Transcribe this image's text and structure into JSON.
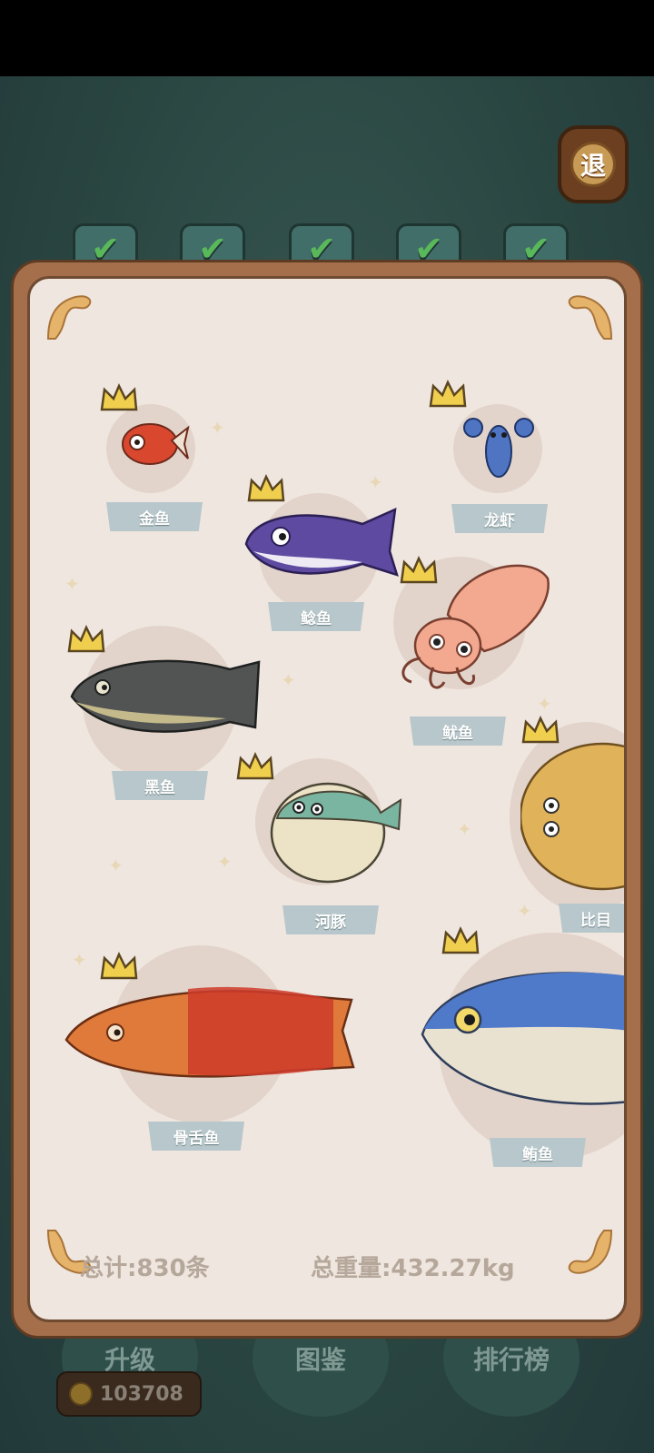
{
  "exit_button": {
    "label": "退"
  },
  "tabs": [
    {
      "label": "",
      "completed": true
    },
    {
      "label": "",
      "completed": true
    },
    {
      "label": "",
      "completed": true
    },
    {
      "label": "",
      "completed": true
    },
    {
      "label": "",
      "completed": true
    }
  ],
  "collection": {
    "fish": [
      {
        "name": "金鱼",
        "crowned": true,
        "icon": "goldfish"
      },
      {
        "name": "龙虾",
        "crowned": true,
        "icon": "lobster"
      },
      {
        "name": "鲶鱼",
        "crowned": true,
        "icon": "catfish"
      },
      {
        "name": "鱿鱼",
        "crowned": true,
        "icon": "squid"
      },
      {
        "name": "黑鱼",
        "crowned": true,
        "icon": "snakehead"
      },
      {
        "name": "河豚",
        "crowned": true,
        "icon": "pufferfish"
      },
      {
        "name": "比目",
        "crowned": true,
        "icon": "flatfish"
      },
      {
        "name": "骨舌鱼",
        "crowned": true,
        "icon": "arowana"
      },
      {
        "name": "鲔鱼",
        "crowned": true,
        "icon": "tuna"
      }
    ],
    "total_count": "总计:830条",
    "total_weight": "总重量:432.27kg"
  },
  "bottom_nav": {
    "upgrade": "升级",
    "atlas": "图鉴",
    "ranking": "排行榜"
  },
  "currency": {
    "amount": "103708",
    "icon": "coin-key-icon"
  },
  "colors": {
    "panel": "#efe6df",
    "frame": "#a56f4c",
    "label": "#b7c7cb",
    "crown": "#f1cf4e",
    "background": "#2c4a45"
  }
}
